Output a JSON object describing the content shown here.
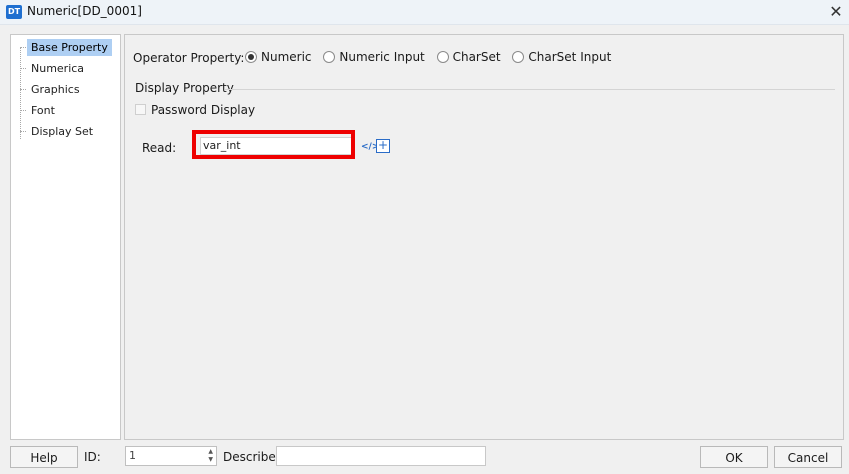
{
  "window": {
    "title": "Numeric[DD_0001]",
    "app_icon_label": "DT",
    "close_glyph": "✕"
  },
  "nav": {
    "items": [
      {
        "label": "Base Property",
        "selected": true
      },
      {
        "label": "Numerica",
        "selected": false
      },
      {
        "label": "Graphics",
        "selected": false
      },
      {
        "label": "Font",
        "selected": false
      },
      {
        "label": "Display Set",
        "selected": false
      }
    ]
  },
  "operator": {
    "label": "Operator Property:",
    "options": [
      {
        "label": "Numeric",
        "checked": true
      },
      {
        "label": "Numeric Input",
        "checked": false
      },
      {
        "label": "CharSet",
        "checked": false
      },
      {
        "label": "CharSet Input",
        "checked": false
      }
    ]
  },
  "display": {
    "group_title": "Display Property",
    "password_label": "Password Display",
    "password_checked": false
  },
  "read": {
    "label": "Read:",
    "value": "var_int",
    "code_icon": "</>",
    "plus_icon": "+"
  },
  "footer": {
    "help_label": "Help",
    "id_label": "ID:",
    "id_value": "1",
    "describe_label": "Describe:",
    "describe_value": "",
    "ok_label": "OK",
    "cancel_label": "Cancel"
  },
  "colors": {
    "highlight_border": "#ee0000",
    "nav_selected": "#aecff3",
    "icon_blue": "#2a6cc7"
  }
}
